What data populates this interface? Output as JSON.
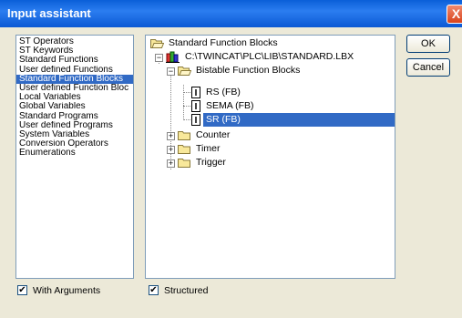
{
  "window": {
    "title": "Input assistant",
    "close_glyph": "X"
  },
  "categories": {
    "items": [
      "ST Operators",
      "ST Keywords",
      "Standard Functions",
      "User defined Functions",
      "Standard Function Blocks",
      "User defined Function Bloc",
      "Local Variables",
      "Global Variables",
      "Standard Programs",
      "User defined Programs",
      "System Variables",
      "Conversion Operators",
      "Enumerations"
    ],
    "selected_index": 4
  },
  "tree": {
    "root": "Standard Function Blocks",
    "library": "C:\\TWINCAT\\PLC\\LIB\\STANDARD.LBX",
    "bistable_folder": "Bistable Function Blocks",
    "fb_rs": "RS (FB)",
    "fb_sema": "SEMA (FB)",
    "fb_sr": "SR (FB)",
    "counter_folder": "Counter",
    "timer_folder": "Timer",
    "trigger_folder": "Trigger",
    "expanded_sign": "−",
    "collapsed_sign": "+"
  },
  "buttons": {
    "ok": "OK",
    "cancel": "Cancel"
  },
  "options": {
    "with_arguments": {
      "label": "With Arguments",
      "checked": true
    },
    "structured": {
      "label": "Structured",
      "checked": true
    }
  },
  "colors": {
    "selection": "#316ac5",
    "title_bar": "#0a5fd8",
    "dialog_bg": "#ece9d8"
  },
  "icons": {
    "folder": "folder-icon",
    "library": "library-icon",
    "function_block": "function-block-icon"
  }
}
